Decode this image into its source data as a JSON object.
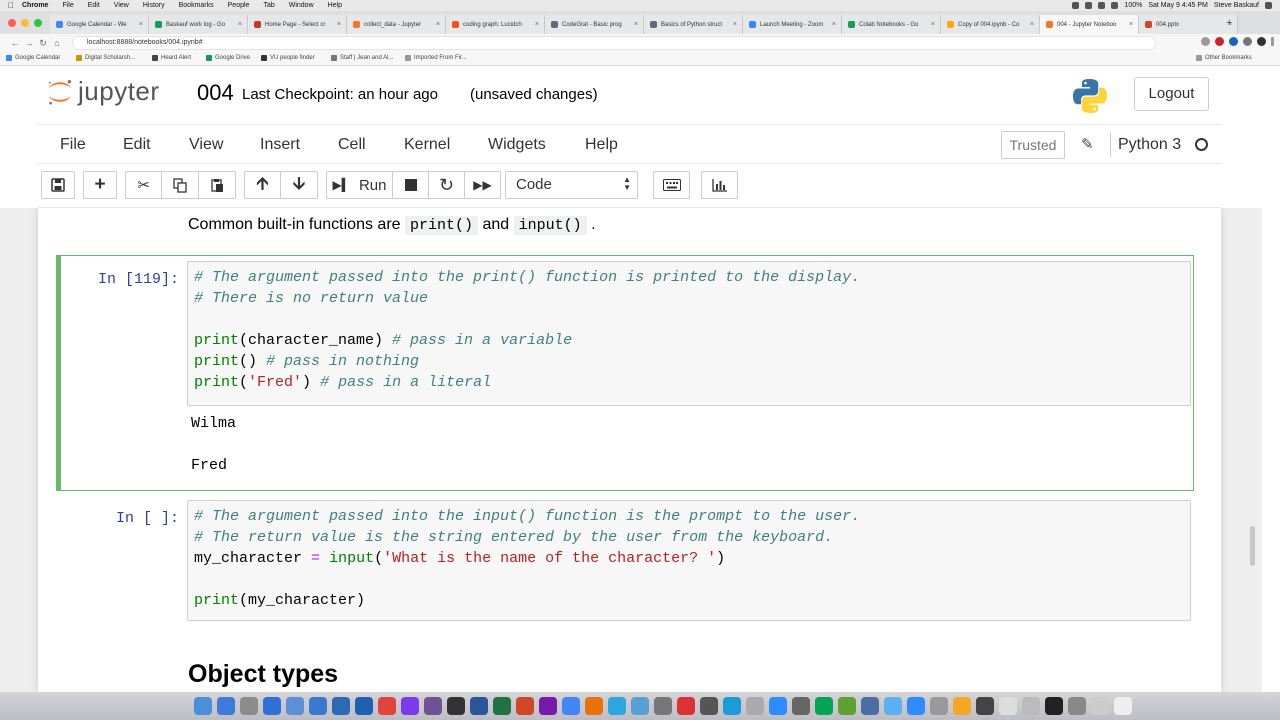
{
  "mac_menu": {
    "app": "Chrome",
    "items": [
      "File",
      "Edit",
      "View",
      "History",
      "Bookmarks",
      "People",
      "Tab",
      "Window",
      "Help"
    ],
    "clock": "Sat May 9  4:45 PM",
    "user": "Steve Baskauf",
    "battery": "100%"
  },
  "browser": {
    "tabs": [
      {
        "label": "Google Calendar - We",
        "color": "#4285f4"
      },
      {
        "label": "Baskauf work log - Go",
        "color": "#0f9d58"
      },
      {
        "label": "Home Page - Select cr",
        "color": "#c0392b"
      },
      {
        "label": "collect_data - Jupyter",
        "color": "#f37726"
      },
      {
        "label": "coding graph: Lucidch",
        "color": "#f4511e"
      },
      {
        "label": "CodeGrat - Basic prog",
        "color": "#5b6b7b"
      },
      {
        "label": "Basics of Python struct",
        "color": "#5b6b7b"
      },
      {
        "label": "Launch Meeting - Zoom",
        "color": "#2d8cff"
      },
      {
        "label": "Colab Notebooks - Go",
        "color": "#0f9d58"
      },
      {
        "label": "Copy of 004.ipynb - Co",
        "color": "#f9ab00"
      },
      {
        "label": "004 - Jupyter Noteboo",
        "color": "#f37726"
      },
      {
        "label": "004.pptx",
        "color": "#d24726"
      }
    ],
    "url": "localhost:8888/notebooks/004.ipynb#",
    "bookmarks": [
      "Google Calendar",
      "Digital Scholarsh...",
      "Heard Alert",
      "Google Drive",
      "VU people finder",
      "Staff | Jean and Al...",
      "Imported From Fir..."
    ],
    "other_bookmarks": "Other Bookmarks"
  },
  "header": {
    "logo_text": "jupyter",
    "notebook_name": "004",
    "checkpoint": "Last Checkpoint: an hour ago",
    "unsaved": "(unsaved changes)",
    "logout": "Logout"
  },
  "menubar": {
    "items": [
      "File",
      "Edit",
      "View",
      "Insert",
      "Cell",
      "Kernel",
      "Widgets",
      "Help"
    ],
    "trusted": "Trusted",
    "kernel": "Python 3"
  },
  "toolbar": {
    "run_label": "Run",
    "cell_type": "Code"
  },
  "notebook": {
    "md_text_prefix": "Common built-in functions are",
    "md_code_1": "print()",
    "md_and": "and",
    "md_code_2": "input()",
    "md_period": ".",
    "cell1": {
      "prompt": "In [119]:",
      "lines": [
        "# The argument passed into the print() function is printed to the display.",
        "# There is no return value",
        "",
        "print(character_name) # pass in a variable",
        "print() # pass in nothing",
        "print('Fred') # pass in a literal"
      ],
      "output": [
        "Wilma",
        "",
        "Fred"
      ]
    },
    "cell2": {
      "prompt": "In [ ]:",
      "lines": [
        "# The argument passed into the input() function is the prompt to the user.",
        "# The return value is the string entered by the user from the keyboard.",
        "my_character = input('What is the name of the character? ')",
        "",
        "print(my_character)"
      ]
    },
    "heading": "Object types"
  }
}
